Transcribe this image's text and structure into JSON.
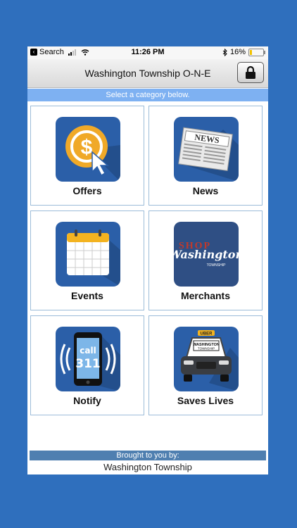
{
  "status_bar": {
    "back_label": "Search",
    "time": "11:26 PM",
    "battery": "16%",
    "battery_level": 0.16
  },
  "header": {
    "title": "Washington Township O-N-E"
  },
  "subheader": "Select a category below.",
  "tiles": [
    {
      "label": "Offers",
      "icon": "dollar-cursor-icon"
    },
    {
      "label": "News",
      "icon": "newspaper-icon"
    },
    {
      "label": "Events",
      "icon": "calendar-icon"
    },
    {
      "label": "Merchants",
      "icon": "shop-washington-logo"
    },
    {
      "label": "Notify",
      "icon": "phone-call-311-icon"
    },
    {
      "label": "Saves Lives",
      "icon": "taxi-car-icon"
    }
  ],
  "icons": {
    "news_headline": "NEWS",
    "merchants_shop": "SHOP",
    "merchants_city": "Washington",
    "merchants_sub": "TOWNSHIP",
    "notify_call": "call",
    "notify_number": "311",
    "car_sign": "UBER",
    "car_plate1": "WASHINGTON",
    "car_plate2": "TOWNSHIP"
  },
  "footer": {
    "brought_by": "Brought to you by:",
    "name": "Washington Township"
  },
  "colors": {
    "background": "#2f6fbd",
    "subbar": "#7eb1f2",
    "icon_tile": "#2b5fa8"
  }
}
